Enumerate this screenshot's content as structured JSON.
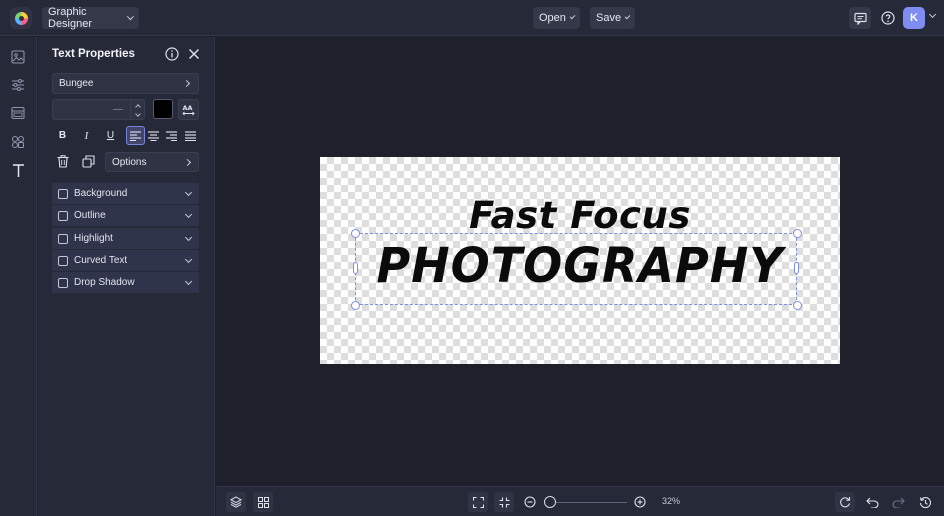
{
  "app": {
    "mode_label": "Graphic Designer",
    "open_label": "Open",
    "save_label": "Save",
    "avatar_initial": "K",
    "accent_color": "#7f8cf2"
  },
  "panel": {
    "title": "Text Properties",
    "font_name": "Bungee",
    "font_size_value": "—",
    "text_color": "#000000",
    "options_label": "Options",
    "effects": [
      {
        "label": "Background",
        "checked": false
      },
      {
        "label": "Outline",
        "checked": false
      },
      {
        "label": "Highlight",
        "checked": false
      },
      {
        "label": "Curved Text",
        "checked": false
      },
      {
        "label": "Drop Shadow",
        "checked": false
      }
    ],
    "format_buttons": {
      "bold": "B",
      "italic": "I",
      "underline": "U"
    },
    "active_alignment": "left"
  },
  "canvas": {
    "line1": "Fast Focus",
    "line2": "PHOTOGRAPHY"
  },
  "bottom": {
    "zoom_text": "32%"
  }
}
